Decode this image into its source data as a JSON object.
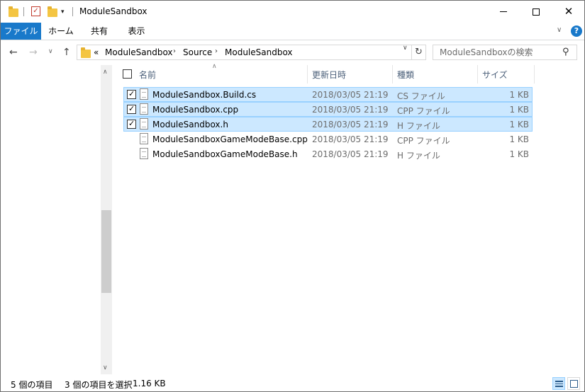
{
  "window": {
    "title": "ModuleSandbox"
  },
  "ribbon": {
    "tabs": [
      {
        "id": "file",
        "label": "ファイル"
      },
      {
        "id": "home",
        "label": "ホーム"
      },
      {
        "id": "share",
        "label": "共有"
      },
      {
        "id": "view",
        "label": "表示"
      }
    ]
  },
  "address": {
    "overflow": "«",
    "crumbs": [
      "ModuleSandbox",
      "Source",
      "ModuleSandbox"
    ]
  },
  "search": {
    "placeholder": "ModuleSandboxの検索"
  },
  "columns": {
    "name": "名前",
    "date": "更新日時",
    "type": "種類",
    "size": "サイズ"
  },
  "files": [
    {
      "name": "ModuleSandbox.Build.cs",
      "date": "2018/03/05 21:19",
      "type": "CS ファイル",
      "size": "1 KB",
      "selected": true
    },
    {
      "name": "ModuleSandbox.cpp",
      "date": "2018/03/05 21:19",
      "type": "CPP ファイル",
      "size": "1 KB",
      "selected": true
    },
    {
      "name": "ModuleSandbox.h",
      "date": "2018/03/05 21:19",
      "type": "H ファイル",
      "size": "1 KB",
      "selected": true
    },
    {
      "name": "ModuleSandboxGameModeBase.cpp",
      "date": "2018/03/05 21:19",
      "type": "CPP ファイル",
      "size": "1 KB",
      "selected": false
    },
    {
      "name": "ModuleSandboxGameModeBase.h",
      "date": "2018/03/05 21:19",
      "type": "H ファイル",
      "size": "1 KB",
      "selected": false
    }
  ],
  "status": {
    "item_count": "5 個の項目",
    "selected": "3 個の項目を選択",
    "selected_size": "1.16 KB"
  },
  "icons": {
    "qa_folder": "folder-icon",
    "properties": "properties-icon",
    "new_folder": "new-folder-icon",
    "customize": "dropdown-icon",
    "back": "back-arrow-icon",
    "forward": "forward-arrow-icon",
    "up": "up-arrow-icon",
    "refresh": "refresh-icon",
    "search": "search-icon",
    "help": "help-icon"
  },
  "colors": {
    "accent": "#1979ca",
    "selection": "#cce8ff",
    "selection_border": "#99d1ff"
  }
}
